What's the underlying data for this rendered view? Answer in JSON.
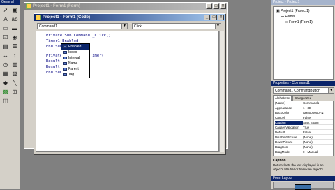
{
  "toolbox": {
    "title": "General",
    "tools": [
      "pointer-icon",
      "picture-icon",
      "label-icon",
      "textbox-icon",
      "frame-icon",
      "button-icon",
      "checkbox-icon",
      "option-icon",
      "combobox-icon",
      "listbox-icon",
      "hscroll-icon",
      "vscroll-icon",
      "timer-icon",
      "drive-icon",
      "dir-icon",
      "file-icon",
      "shape-icon",
      "line-icon",
      "image-icon",
      "data-icon",
      "ole-icon"
    ]
  },
  "form_window": {
    "title": "Project1 - Form1 (Form)"
  },
  "code_window": {
    "title": "Project1 - Form1 (Code)",
    "object_combo": "Command1",
    "proc_combo": "Click",
    "lines": [
      "Private Sub Command1_Click()",
      "Timer1.Enabled",
      "End Sub",
      "Private Sub Timer1_Timer()",
      "Result",
      "Result",
      "End Sub"
    ]
  },
  "popup": {
    "items": [
      "Enabled",
      "Index",
      "Interval",
      "Name",
      "Parent",
      "Tag"
    ],
    "selected": 0
  },
  "project": {
    "title": "Project - Project1",
    "tree": [
      "Project1 (Project1)",
      "Forms",
      "Form1 (Form1)"
    ]
  },
  "properties": {
    "title": "Properties - Command1",
    "object": "Command1 CommandButton",
    "tabs": [
      "Alphabetic",
      "Categorized"
    ],
    "rows": [
      {
        "k": "(Name)",
        "v": "Command1"
      },
      {
        "k": "Appearance",
        "v": "1 - 3D"
      },
      {
        "k": "BackColor",
        "v": "&H8000000F&"
      },
      {
        "k": "Cancel",
        "v": "False"
      },
      {
        "k": "Caption",
        "v": "Start Spam"
      },
      {
        "k": "CausesValidation",
        "v": "True"
      },
      {
        "k": "Default",
        "v": "False"
      },
      {
        "k": "DisabledPicture",
        "v": "(None)"
      },
      {
        "k": "DownPicture",
        "v": "(None)"
      },
      {
        "k": "DragIcon",
        "v": "(None)"
      },
      {
        "k": "DragMode",
        "v": "0 - Manual"
      }
    ],
    "selected_row": 4,
    "desc_title": "Caption",
    "desc_text": "Returns/sets the text displayed in an object's title bar or below an object's"
  },
  "layout_panel": {
    "title": "Form Layout"
  }
}
